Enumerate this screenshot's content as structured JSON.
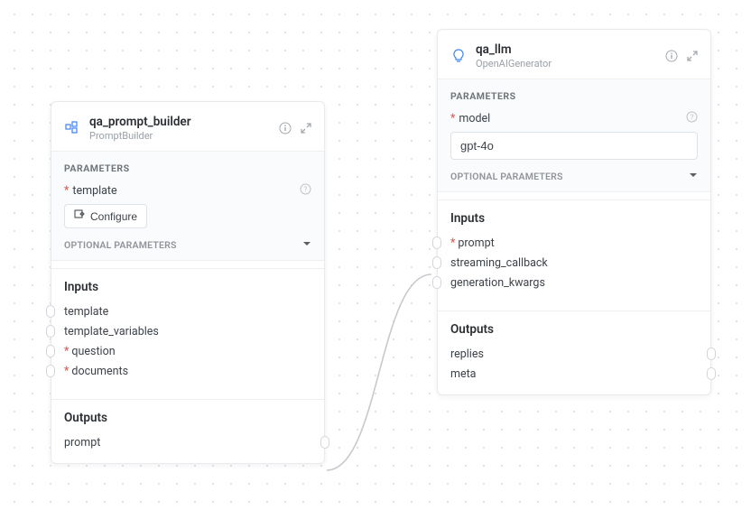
{
  "nodes": {
    "prompt_builder": {
      "title": "qa_prompt_builder",
      "subtitle": "PromptBuilder",
      "params_heading": "PARAMETERS",
      "param1_label": "template",
      "configure_label": "Configure",
      "optional_label": "OPTIONAL PARAMETERS",
      "inputs_heading": "Inputs",
      "inputs": {
        "template": "template",
        "template_variables": "template_variables",
        "question": "question",
        "documents": "documents"
      },
      "outputs_heading": "Outputs",
      "outputs": {
        "prompt": "prompt"
      }
    },
    "llm": {
      "title": "qa_llm",
      "subtitle": "OpenAIGenerator",
      "params_heading": "PARAMETERS",
      "param1_label": "model",
      "model_value": "gpt-4o",
      "optional_label": "OPTIONAL PARAMETERS",
      "inputs_heading": "Inputs",
      "inputs": {
        "prompt": "prompt",
        "streaming_callback": "streaming_callback",
        "generation_kwargs": "generation_kwargs"
      },
      "outputs_heading": "Outputs",
      "outputs": {
        "replies": "replies",
        "meta": "meta"
      }
    }
  }
}
